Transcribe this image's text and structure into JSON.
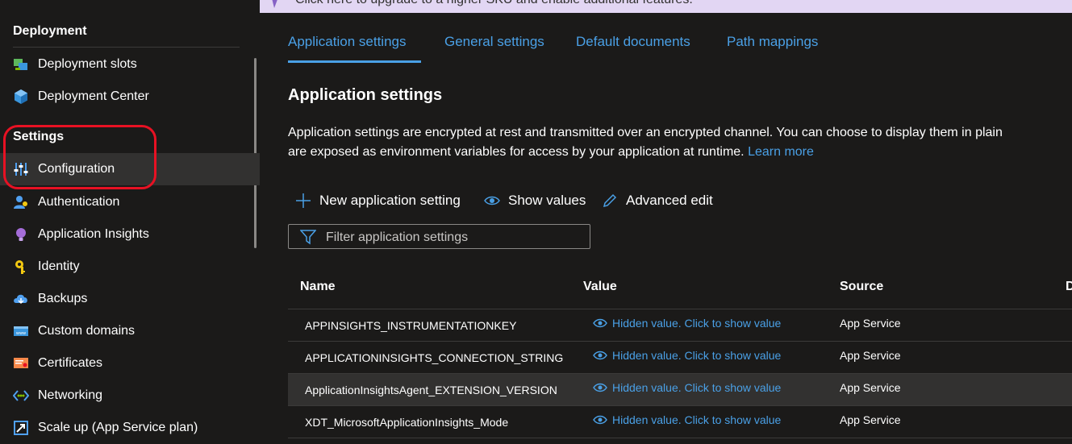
{
  "banner": {
    "text": "Click here to upgrade to a higher SKU and enable additional features."
  },
  "sidebar": {
    "groups": [
      {
        "title": "Deployment"
      },
      {
        "title": "Settings"
      }
    ],
    "items": [
      {
        "label": "Deployment slots",
        "icon": "deployment-slots-icon"
      },
      {
        "label": "Deployment Center",
        "icon": "deployment-center-icon"
      },
      {
        "label": "Configuration",
        "icon": "configuration-icon",
        "selected": true
      },
      {
        "label": "Authentication",
        "icon": "authentication-icon"
      },
      {
        "label": "Application Insights",
        "icon": "application-insights-icon"
      },
      {
        "label": "Identity",
        "icon": "identity-icon"
      },
      {
        "label": "Backups",
        "icon": "backups-icon"
      },
      {
        "label": "Custom domains",
        "icon": "custom-domains-icon"
      },
      {
        "label": "Certificates",
        "icon": "certificates-icon"
      },
      {
        "label": "Networking",
        "icon": "networking-icon"
      },
      {
        "label": "Scale up (App Service plan)",
        "icon": "scale-up-icon"
      }
    ]
  },
  "tabs": [
    {
      "label": "Application settings",
      "active": true
    },
    {
      "label": "General settings"
    },
    {
      "label": "Default documents"
    },
    {
      "label": "Path mappings"
    }
  ],
  "section": {
    "title": "Application settings",
    "desc_line1": "Application settings are encrypted at rest and transmitted over an encrypted channel. You can choose to display them in plain",
    "desc_line2": "are exposed as environment variables for access by your application at runtime.",
    "learn_more": "Learn more"
  },
  "toolbar": {
    "new_label": "New application setting",
    "show_label": "Show values",
    "edit_label": "Advanced edit"
  },
  "filter": {
    "placeholder": "Filter application settings"
  },
  "table": {
    "headers": {
      "name": "Name",
      "value": "Value",
      "source": "Source",
      "extra": "D"
    },
    "rows": [
      {
        "name": "APPINSIGHTS_INSTRUMENTATIONKEY",
        "value": "Hidden value. Click to show value",
        "source": "App Service"
      },
      {
        "name": "APPLICATIONINSIGHTS_CONNECTION_STRING",
        "value": "Hidden value. Click to show value",
        "source": "App Service"
      },
      {
        "name": "ApplicationInsightsAgent_EXTENSION_VERSION",
        "value": "Hidden value. Click to show value",
        "source": "App Service"
      },
      {
        "name": "XDT_MicrosoftApplicationInsights_Mode",
        "value": "Hidden value. Click to show value",
        "source": "App Service"
      }
    ]
  },
  "colors": {
    "accent": "#4aa0e6",
    "highlight": "#e81123",
    "background": "#1b1a19",
    "banner": "#e2d6f3"
  }
}
